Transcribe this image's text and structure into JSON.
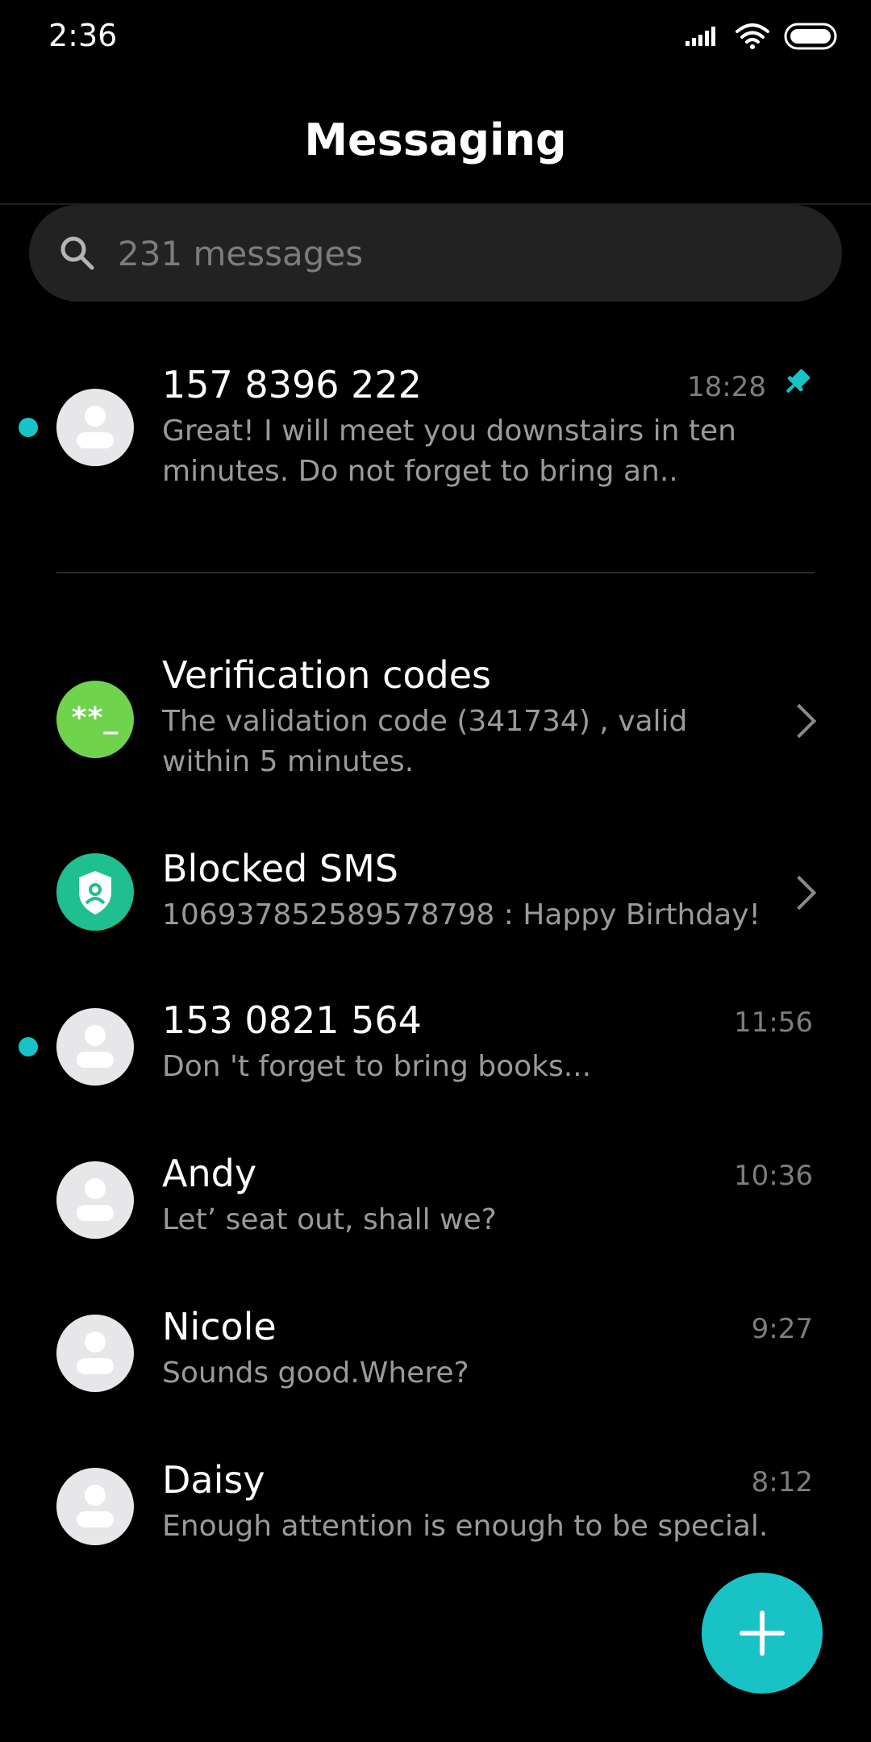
{
  "status_bar": {
    "time": "2:36",
    "icons": [
      "signal-icon",
      "wifi-icon",
      "battery-icon"
    ]
  },
  "header": {
    "title": "Messaging"
  },
  "search": {
    "placeholder": "231 messages"
  },
  "threads": [
    {
      "name": "157 8396 222",
      "preview": "Great! I will meet you downstairs in ten minutes. Do not forget to bring an..",
      "time": "18:28",
      "unread": true,
      "pinned": true,
      "avatar": "person-avatar-icon"
    },
    {
      "name": "Verification codes",
      "preview": "The validation code (341734) , valid within 5 minutes.",
      "avatar": "verification-code-icon",
      "avatar_text": "**_",
      "color": "#6fd34d"
    },
    {
      "name": "Blocked SMS",
      "preview": "106937852589578798 : Happy Birthday!",
      "avatar": "shield-icon",
      "color": "#1fbf8f"
    },
    {
      "name": "153 0821 564",
      "preview": "Don 't forget to bring books...",
      "time": "11:56",
      "unread": true,
      "avatar": "person-avatar-icon"
    },
    {
      "name": "Andy",
      "preview": "Let’ seat out, shall we?",
      "time": "10:36",
      "avatar": "person-avatar-icon"
    },
    {
      "name": "Nicole",
      "preview": "Sounds good.Where?",
      "time": "9:27",
      "avatar": "person-avatar-icon"
    },
    {
      "name": "Daisy",
      "preview": "Enough attention is enough to be special.",
      "time": "8:12",
      "avatar": "person-avatar-icon"
    }
  ],
  "fab": {
    "icon": "plus-icon"
  },
  "colors": {
    "accent": "#17c3c6",
    "background": "#000000",
    "search_bg": "#222222"
  }
}
